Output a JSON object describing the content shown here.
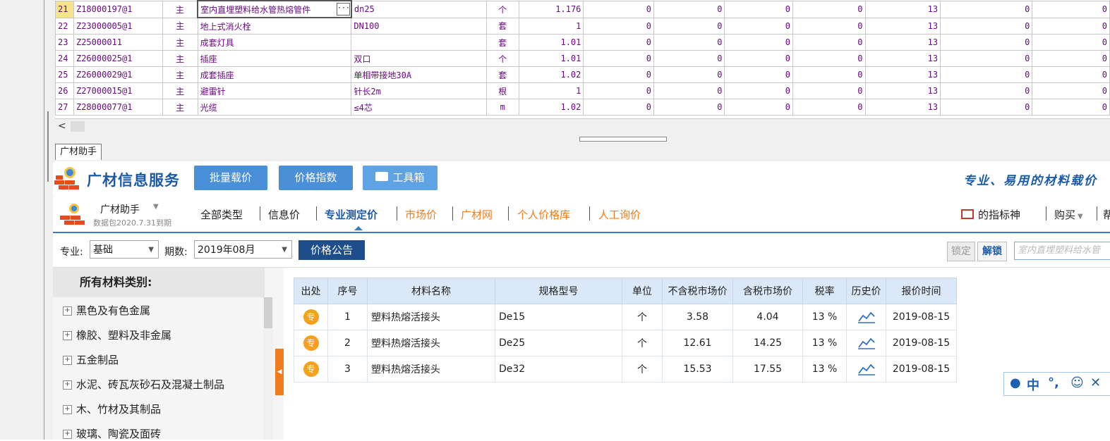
{
  "grid": {
    "rows": [
      {
        "idx": "21",
        "code": "Z18000197@1",
        "type": "主",
        "name": "室内直埋塑料给水管热熔管件",
        "spec": "dn25",
        "unit": "个",
        "qty": "1.176",
        "c1": "0",
        "c2": "0",
        "c3": "0",
        "c4": "0",
        "rate": "13",
        "c5": "0",
        "c6": "0"
      },
      {
        "idx": "22",
        "code": "Z23000005@1",
        "type": "主",
        "name": "地上式消火栓",
        "spec": "DN100",
        "unit": "套",
        "qty": "1",
        "c1": "0",
        "c2": "0",
        "c3": "0",
        "c4": "0",
        "rate": "13",
        "c5": "0",
        "c6": "0"
      },
      {
        "idx": "23",
        "code": "Z25000011",
        "type": "主",
        "name": "成套灯具",
        "spec": "",
        "unit": "套",
        "qty": "1.01",
        "c1": "0",
        "c2": "0",
        "c3": "0",
        "c4": "0",
        "rate": "13",
        "c5": "0",
        "c6": "0"
      },
      {
        "idx": "24",
        "code": "Z26000025@1",
        "type": "主",
        "name": "插座",
        "spec": "双口",
        "unit": "个",
        "qty": "1.01",
        "c1": "0",
        "c2": "0",
        "c3": "0",
        "c4": "0",
        "rate": "13",
        "c5": "0",
        "c6": "0"
      },
      {
        "idx": "25",
        "code": "Z26000029@1",
        "type": "主",
        "name": "成套插座",
        "spec": "单相带接地30A",
        "unit": "套",
        "qty": "1.02",
        "c1": "0",
        "c2": "0",
        "c3": "0",
        "c4": "0",
        "rate": "13",
        "c5": "0",
        "c6": "0"
      },
      {
        "idx": "26",
        "code": "Z27000015@1",
        "type": "主",
        "name": "避雷针",
        "spec": "针长2m",
        "unit": "根",
        "qty": "1",
        "c1": "0",
        "c2": "0",
        "c3": "0",
        "c4": "0",
        "rate": "13",
        "c5": "0",
        "c6": "0"
      },
      {
        "idx": "27",
        "code": "Z28000077@1",
        "type": "主",
        "name": "光缆",
        "spec": "≤4芯",
        "unit": "m",
        "qty": "1.02",
        "c1": "0",
        "c2": "0",
        "c3": "0",
        "c4": "0",
        "rate": "13",
        "c5": "0",
        "c6": "0"
      }
    ],
    "ellipsis": "···"
  },
  "scroll": {
    "left_arrow": "<"
  },
  "tabstrip": {
    "tab_label": "广材助手"
  },
  "header": {
    "brand": "广材信息服务",
    "btn_batch": "批量载价",
    "btn_index": "价格指数",
    "btn_toolbox": "工具箱",
    "slogan": "专业、易用的材料载价"
  },
  "nav": {
    "assistant": "广材助手",
    "data_package": "数据包2020.7.31到期",
    "tabs": [
      "全部类型",
      "信息价",
      "专业测定价",
      "市场价",
      "广材网",
      "个人价格库",
      "人工询价"
    ],
    "indicator_god": "的指标神",
    "buy": "购买",
    "help": "帮"
  },
  "filter": {
    "specialty_label": "专业:",
    "specialty_value": "基础",
    "period_label": "期数:",
    "period_value": "2019年08月",
    "notice_btn": "价格公告",
    "lock": "锁定",
    "unlock": "解锁",
    "search_value": "室内直埋塑料给水管"
  },
  "categories": {
    "title": "所有材料类别:",
    "items": [
      "黑色及有色金属",
      "橡胶、塑料及非金属",
      "五金制品",
      "水泥、砖瓦灰砂石及混凝土制品",
      "木、竹材及其制品",
      "玻璃、陶瓷及面砖"
    ]
  },
  "results": {
    "headers": [
      "出处",
      "序号",
      "材料名称",
      "规格型号",
      "单位",
      "不含税市场价",
      "含税市场价",
      "税率",
      "历史价",
      "报价时间"
    ],
    "badge": "专",
    "rows": [
      {
        "seq": "1",
        "name": "塑料热熔活接头",
        "spec": "De15",
        "unit": "个",
        "price_ex": "3.58",
        "price_in": "4.04",
        "tax": "13 %",
        "date": "2019-08-15"
      },
      {
        "seq": "2",
        "name": "塑料热熔活接头",
        "spec": "De25",
        "unit": "个",
        "price_ex": "12.61",
        "price_in": "14.25",
        "tax": "13 %",
        "date": "2019-08-15"
      },
      {
        "seq": "3",
        "name": "塑料热熔活接头",
        "spec": "De32",
        "unit": "个",
        "price_ex": "15.53",
        "price_in": "17.55",
        "tax": "13 %",
        "date": "2019-08-15"
      }
    ]
  },
  "ime": {
    "mode": "中",
    "punct": "°,",
    "emoji": "☺"
  },
  "colors": {
    "brand_blue": "#1b5aa6",
    "button_blue": "#4a90d9",
    "orange": "#f07c1e",
    "grid_text": "#6a0b82"
  }
}
